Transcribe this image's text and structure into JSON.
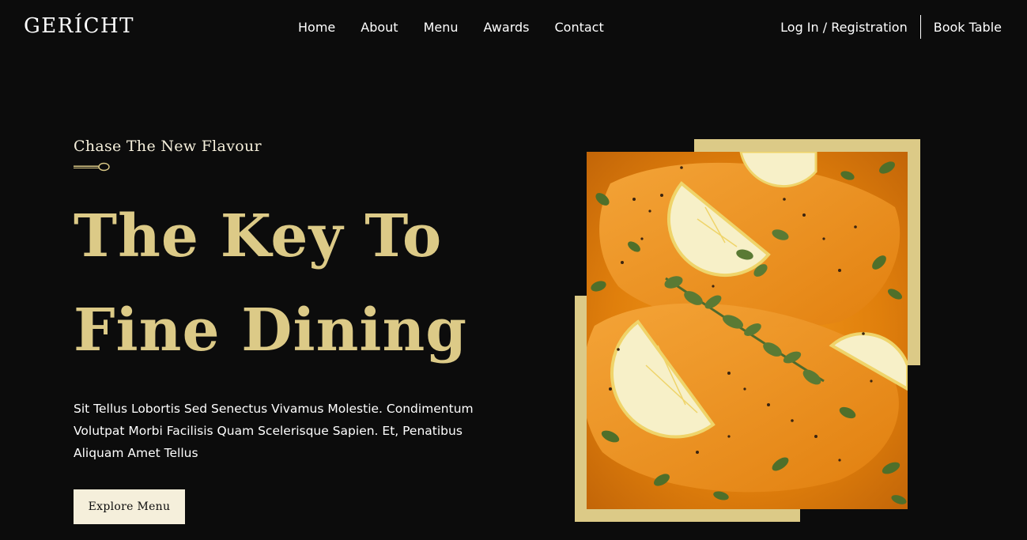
{
  "nav": {
    "logo": "GERÍCHT",
    "links": [
      "Home",
      "About",
      "Menu",
      "Awards",
      "Contact"
    ],
    "login": "Log In / Registration",
    "book": "Book Table"
  },
  "hero": {
    "subtitle": "Chase The New Flavour",
    "title_line1": "The Key To",
    "title_line2": "Fine Dining",
    "description": "Sit Tellus Lobortis Sed Senectus Vivamus Molestie. Condimentum Volutpat Morbi Facilisis Quam Scelerisque Sapien. Et, Penatibus Aliquam Amet Tellus",
    "button": "Explore Menu"
  },
  "colors": {
    "background": "#0c0c0c",
    "gold": "#dcca87",
    "cream": "#f5efdb",
    "white": "#ffffff"
  },
  "icons": {
    "spoon": "spoon-icon",
    "image": "salmon-dish-image"
  }
}
